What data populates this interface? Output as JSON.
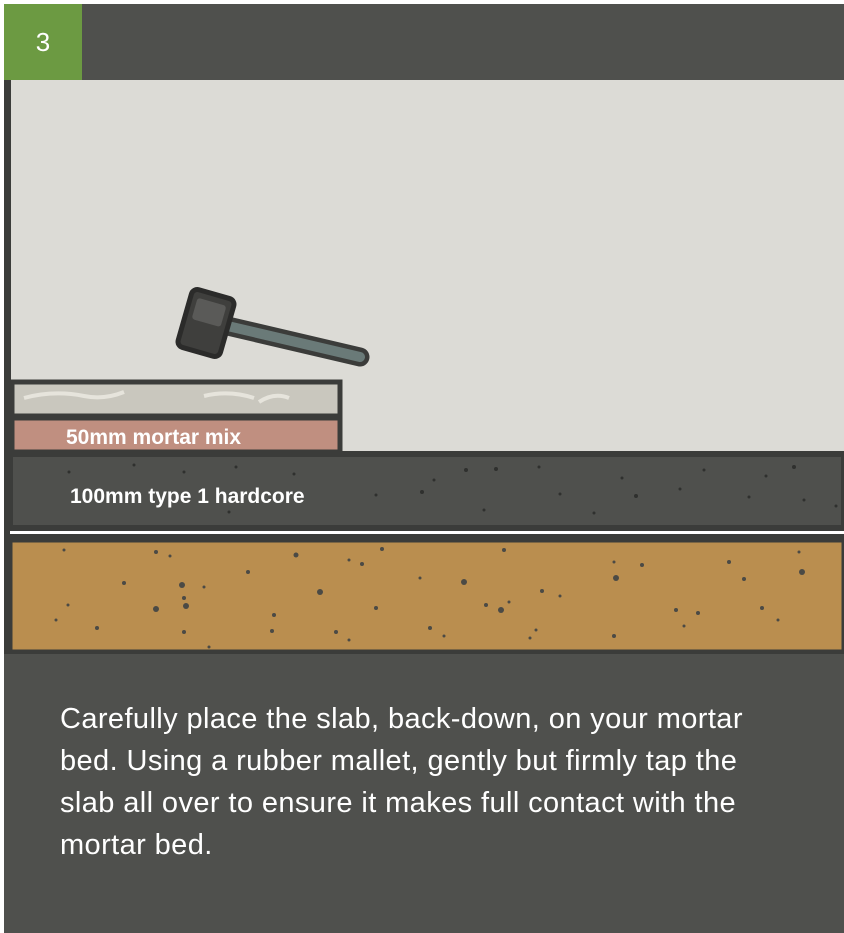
{
  "step": {
    "number": "3"
  },
  "diagram": {
    "layers": [
      {
        "id": "slab",
        "label": "",
        "color": "#c9c7be"
      },
      {
        "id": "mortar",
        "label": "50mm mortar mix",
        "color": "#c08f80"
      },
      {
        "id": "hardcore",
        "label": "100mm type 1 hardcore",
        "color": "#4f504d"
      },
      {
        "id": "soil",
        "label": "",
        "color": "#ba8e4f"
      }
    ],
    "tool": {
      "icon": "rubber-mallet-icon"
    },
    "colors": {
      "background": "#dcdbd6",
      "frame": "#3b3c3a",
      "accent": "#6c9a42"
    }
  },
  "caption": "Carefully place the slab, back-down, on your mortar bed. Using a rubber mallet, gently but firmly tap the slab all over to ensure it makes full contact with the mortar bed."
}
